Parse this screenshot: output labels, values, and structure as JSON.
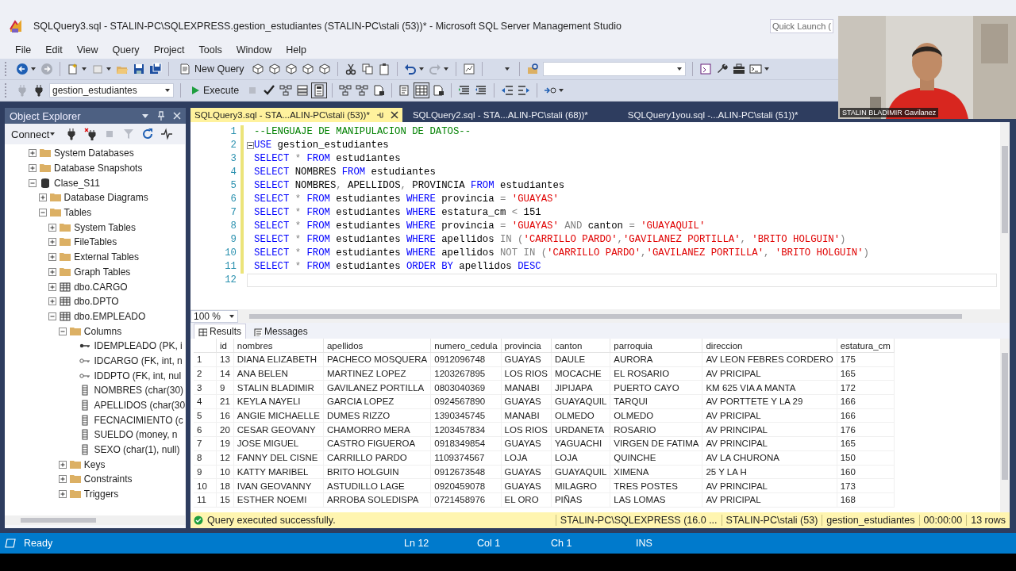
{
  "window": {
    "title": "SQLQuery3.sql - STALIN-PC\\SQLEXPRESS.gestion_estudiantes (STALIN-PC\\stali (53))* - Microsoft SQL Server Management Studio"
  },
  "quick_launch": {
    "placeholder": "Quick Launch ("
  },
  "menu": [
    "File",
    "Edit",
    "View",
    "Query",
    "Project",
    "Tools",
    "Window",
    "Help"
  ],
  "toolbar": {
    "new_query": "New Query",
    "database": "gestion_estudiantes",
    "execute": "Execute"
  },
  "object_explorer": {
    "title": "Object Explorer",
    "connect": "Connect",
    "tree": [
      {
        "label": "System Databases",
        "kind": "folder",
        "expanded": false
      },
      {
        "label": "Database Snapshots",
        "kind": "folder",
        "expanded": false
      },
      {
        "label": "Clase_S11",
        "kind": "database",
        "expanded": true,
        "children": [
          {
            "label": "Database Diagrams",
            "kind": "folder",
            "expanded": false
          },
          {
            "label": "Tables",
            "kind": "folder",
            "expanded": true,
            "children": [
              {
                "label": "System Tables",
                "kind": "folder",
                "expanded": false
              },
              {
                "label": "FileTables",
                "kind": "folder",
                "expanded": false
              },
              {
                "label": "External Tables",
                "kind": "folder",
                "expanded": false
              },
              {
                "label": "Graph Tables",
                "kind": "folder",
                "expanded": false
              },
              {
                "label": "dbo.CARGO",
                "kind": "table",
                "expanded": false
              },
              {
                "label": "dbo.DPTO",
                "kind": "table",
                "expanded": false
              },
              {
                "label": "dbo.EMPLEADO",
                "kind": "table",
                "expanded": true,
                "children": [
                  {
                    "label": "Columns",
                    "kind": "folder",
                    "expanded": true,
                    "children": [
                      {
                        "label": "IDEMPLEADO (PK, i",
                        "kind": "pk"
                      },
                      {
                        "label": "IDCARGO (FK, int, n",
                        "kind": "fk"
                      },
                      {
                        "label": "IDDPTO (FK, int, nul",
                        "kind": "fk"
                      },
                      {
                        "label": "NOMBRES (char(30)",
                        "kind": "column"
                      },
                      {
                        "label": "APELLIDOS (char(30",
                        "kind": "column"
                      },
                      {
                        "label": "FECNACIMIENTO (c",
                        "kind": "column"
                      },
                      {
                        "label": "SUELDO (money, n",
                        "kind": "column"
                      },
                      {
                        "label": "SEXO (char(1), null)",
                        "kind": "column"
                      }
                    ]
                  },
                  {
                    "label": "Keys",
                    "kind": "folder",
                    "expanded": false
                  },
                  {
                    "label": "Constraints",
                    "kind": "folder",
                    "expanded": false
                  },
                  {
                    "label": "Triggers",
                    "kind": "folder",
                    "expanded": false
                  }
                ]
              }
            ]
          }
        ]
      }
    ]
  },
  "editor_tabs": [
    {
      "label": "SQLQuery3.sql - STA...ALIN-PC\\stali (53))*",
      "selected": true
    },
    {
      "label": "SQLQuery2.sql - STA...ALIN-PC\\stali (68))*",
      "selected": false
    },
    {
      "label": "SQLQuery1you.sql -...ALIN-PC\\stali (51))*",
      "selected": false
    }
  ],
  "code_lines": [
    {
      "number": "1",
      "fold": false,
      "current": false,
      "tokens": [
        {
          "kind": "comment",
          "text": "--LENGUAJE DE MANIPULACION DE DATOS--"
        }
      ]
    },
    {
      "number": "2",
      "fold": true,
      "current": false,
      "tokens": [
        {
          "kind": "keyword",
          "text": "USE"
        },
        {
          "kind": "plain",
          "text": " gestion_estudiantes"
        }
      ]
    },
    {
      "number": "3",
      "fold": false,
      "current": false,
      "tokens": [
        {
          "kind": "keyword",
          "text": "SELECT"
        },
        {
          "kind": "operator",
          "text": " *"
        },
        {
          "kind": "keyword",
          "text": " FROM"
        },
        {
          "kind": "plain",
          "text": " estudiantes"
        }
      ]
    },
    {
      "number": "4",
      "fold": false,
      "current": false,
      "tokens": [
        {
          "kind": "keyword",
          "text": "SELECT"
        },
        {
          "kind": "plain",
          "text": " NOMBRES "
        },
        {
          "kind": "keyword",
          "text": "FROM"
        },
        {
          "kind": "plain",
          "text": " estudiantes"
        }
      ]
    },
    {
      "number": "5",
      "fold": false,
      "current": false,
      "tokens": [
        {
          "kind": "keyword",
          "text": "SELECT"
        },
        {
          "kind": "plain",
          "text": " NOMBRES"
        },
        {
          "kind": "operator",
          "text": ","
        },
        {
          "kind": "plain",
          "text": " APELLIDOS"
        },
        {
          "kind": "operator",
          "text": ","
        },
        {
          "kind": "plain",
          "text": " PROVINCIA "
        },
        {
          "kind": "keyword",
          "text": "FROM"
        },
        {
          "kind": "plain",
          "text": " estudiantes"
        }
      ]
    },
    {
      "number": "6",
      "fold": false,
      "current": false,
      "tokens": [
        {
          "kind": "keyword",
          "text": "SELECT"
        },
        {
          "kind": "operator",
          "text": " *"
        },
        {
          "kind": "keyword",
          "text": " FROM"
        },
        {
          "kind": "plain",
          "text": " estudiantes "
        },
        {
          "kind": "keyword",
          "text": "WHERE"
        },
        {
          "kind": "plain",
          "text": " provincia "
        },
        {
          "kind": "operator",
          "text": "="
        },
        {
          "kind": "string",
          "text": " 'GUAYAS'"
        }
      ]
    },
    {
      "number": "7",
      "fold": false,
      "current": false,
      "tokens": [
        {
          "kind": "keyword",
          "text": "SELECT"
        },
        {
          "kind": "operator",
          "text": " *"
        },
        {
          "kind": "keyword",
          "text": " FROM"
        },
        {
          "kind": "plain",
          "text": " estudiantes "
        },
        {
          "kind": "keyword",
          "text": "WHERE"
        },
        {
          "kind": "plain",
          "text": " estatura_cm "
        },
        {
          "kind": "operator",
          "text": "<"
        },
        {
          "kind": "plain",
          "text": " 151"
        }
      ]
    },
    {
      "number": "8",
      "fold": false,
      "current": false,
      "tokens": [
        {
          "kind": "keyword",
          "text": "SELECT"
        },
        {
          "kind": "operator",
          "text": " *"
        },
        {
          "kind": "keyword",
          "text": " FROM"
        },
        {
          "kind": "plain",
          "text": " estudiantes "
        },
        {
          "kind": "keyword",
          "text": "WHERE"
        },
        {
          "kind": "plain",
          "text": " provincia "
        },
        {
          "kind": "operator",
          "text": "="
        },
        {
          "kind": "string",
          "text": " 'GUAYAS'"
        },
        {
          "kind": "operator",
          "text": " AND"
        },
        {
          "kind": "plain",
          "text": " canton "
        },
        {
          "kind": "operator",
          "text": "="
        },
        {
          "kind": "string",
          "text": " 'GUAYAQUIL'"
        }
      ]
    },
    {
      "number": "9",
      "fold": false,
      "current": false,
      "tokens": [
        {
          "kind": "keyword",
          "text": "SELECT"
        },
        {
          "kind": "operator",
          "text": " *"
        },
        {
          "kind": "keyword",
          "text": " FROM"
        },
        {
          "kind": "plain",
          "text": " estudiantes "
        },
        {
          "kind": "keyword",
          "text": "WHERE"
        },
        {
          "kind": "plain",
          "text": " apellidos "
        },
        {
          "kind": "operator",
          "text": "IN ("
        },
        {
          "kind": "string",
          "text": "'CARRILLO PARDO'"
        },
        {
          "kind": "operator",
          "text": ","
        },
        {
          "kind": "string",
          "text": "'GAVILANEZ PORTILLA'"
        },
        {
          "kind": "operator",
          "text": ","
        },
        {
          "kind": "string",
          "text": " 'BRITO HOLGUIN'"
        },
        {
          "kind": "operator",
          "text": ")"
        }
      ]
    },
    {
      "number": "10",
      "fold": false,
      "current": false,
      "tokens": [
        {
          "kind": "keyword",
          "text": "SELECT"
        },
        {
          "kind": "operator",
          "text": " *"
        },
        {
          "kind": "keyword",
          "text": " FROM"
        },
        {
          "kind": "plain",
          "text": " estudiantes "
        },
        {
          "kind": "keyword",
          "text": "WHERE"
        },
        {
          "kind": "plain",
          "text": " apellidos "
        },
        {
          "kind": "operator",
          "text": "NOT IN ("
        },
        {
          "kind": "string",
          "text": "'CARRILLO PARDO'"
        },
        {
          "kind": "operator",
          "text": ","
        },
        {
          "kind": "string",
          "text": "'GAVILANEZ PORTILLA'"
        },
        {
          "kind": "operator",
          "text": ","
        },
        {
          "kind": "string",
          "text": " 'BRITO HOLGUIN'"
        },
        {
          "kind": "operator",
          "text": ")"
        }
      ]
    },
    {
      "number": "11",
      "fold": false,
      "current": false,
      "tokens": [
        {
          "kind": "keyword",
          "text": "SELECT"
        },
        {
          "kind": "operator",
          "text": " *"
        },
        {
          "kind": "keyword",
          "text": " FROM"
        },
        {
          "kind": "plain",
          "text": " estudiantes "
        },
        {
          "kind": "keyword",
          "text": "ORDER BY"
        },
        {
          "kind": "plain",
          "text": " apellidos "
        },
        {
          "kind": "keyword",
          "text": "DESC"
        }
      ]
    },
    {
      "number": "12",
      "fold": false,
      "current": true
    }
  ],
  "zoom": "100 %",
  "result_tabs": [
    {
      "label": "Results",
      "selected": true
    },
    {
      "label": "Messages",
      "selected": false
    }
  ],
  "results": {
    "columns": [
      "",
      "id",
      "nombres",
      "apellidos",
      "numero_cedula",
      "provincia",
      "canton",
      "parroquia",
      "direccion",
      "estatura_cm"
    ],
    "rows": [
      [
        "1",
        "13",
        "DIANA ELIZABETH",
        "PACHECO MOSQUERA",
        "0912096748",
        "GUAYAS",
        "DAULE",
        "AURORA",
        "AV LEON FEBRES CORDERO",
        "175"
      ],
      [
        "2",
        "14",
        "ANA BELEN",
        "MARTINEZ LOPEZ",
        "1203267895",
        "LOS RIOS",
        "MOCACHE",
        "EL ROSARIO",
        "AV PRICIPAL",
        "165"
      ],
      [
        "3",
        "9",
        "STALIN BLADIMIR",
        "GAVILANEZ PORTILLA",
        "0803040369",
        "MANABI",
        "JIPIJAPA",
        "PUERTO CAYO",
        "KM 625 VIA A MANTA",
        "172"
      ],
      [
        "4",
        "21",
        "KEYLA NAYELI",
        "GARCIA LOPEZ",
        "0924567890",
        "GUAYAS",
        "GUAYAQUIL",
        "TARQUI",
        "AV PORTTETE Y LA 29",
        "166"
      ],
      [
        "5",
        "16",
        "ANGIE MICHAELLE",
        "DUMES RIZZO",
        "1390345745",
        "MANABI",
        "OLMEDO",
        "OLMEDO",
        "AV PRICIPAL",
        "166"
      ],
      [
        "6",
        "20",
        "CESAR GEOVANY",
        "CHAMORRO MERA",
        "1203457834",
        "LOS RIOS",
        "URDANETA",
        "ROSARIO",
        "AV PRINCIPAL",
        "176"
      ],
      [
        "7",
        "19",
        "JOSE MIGUEL",
        "CASTRO FIGUEROA",
        "0918349854",
        "GUAYAS",
        "YAGUACHI",
        "VIRGEN DE FATIMA",
        "AV PRINCIPAL",
        "165"
      ],
      [
        "8",
        "12",
        "FANNY DEL CISNE",
        "CARRILLO PARDO",
        "1109374567",
        "LOJA",
        "LOJA",
        "QUINCHE",
        "AV LA CHURONA",
        "150"
      ],
      [
        "9",
        "10",
        "KATTY MARIBEL",
        "BRITO HOLGUIN",
        "0912673548",
        "GUAYAS",
        "GUAYAQUIL",
        "XIMENA",
        "25 Y LA H",
        "160"
      ],
      [
        "10",
        "18",
        "IVAN GEOVANNY",
        "ASTUDILLO LAGE",
        "0920459078",
        "GUAYAS",
        "MILAGRO",
        "TRES POSTES",
        "AV PRINCIPAL",
        "173"
      ],
      [
        "11",
        "15",
        "ESTHER NOEMI",
        "ARROBA SOLEDISPA",
        "0721458976",
        "EL ORO",
        "PIÑAS",
        "LAS LOMAS",
        "AV PRICIPAL",
        "168"
      ]
    ]
  },
  "query_status": {
    "message": "Query executed successfully.",
    "segments": [
      "STALIN-PC\\SQLEXPRESS (16.0 ...",
      "STALIN-PC\\stali (53)",
      "gestion_estudiantes",
      "00:00:00",
      "13 rows"
    ]
  },
  "status_bar": {
    "state": "Ready",
    "line": "Ln 12",
    "column": "Col 1",
    "char": "Ch 1",
    "mode": "INS"
  },
  "webcam": {
    "kind": "picture",
    "name_label": "STALIN BLADIMIR Gavilanez"
  }
}
